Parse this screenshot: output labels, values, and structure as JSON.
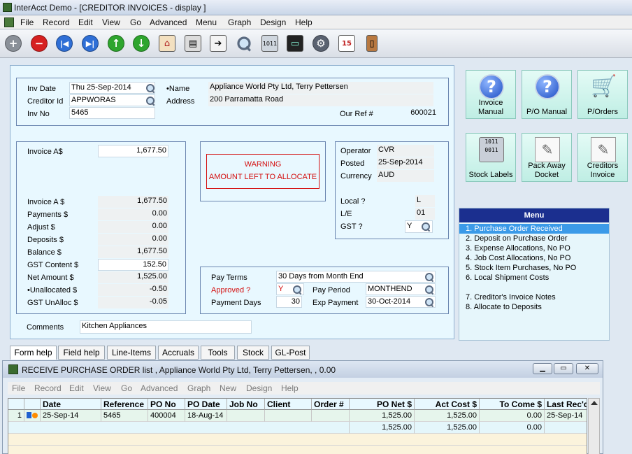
{
  "window": {
    "title": "InterAcct Demo - [CREDITOR INVOICES - display ]"
  },
  "menubar": [
    "File",
    "Record",
    "Edit",
    "View",
    "Go",
    "Advanced",
    "Menu",
    "Graph",
    "Design",
    "Help"
  ],
  "header": {
    "inv_date_label": "Inv Date",
    "inv_date": "Thu 25-Sep-2014",
    "creditor_id_label": "Creditor Id",
    "creditor_id": "APPWORAS",
    "inv_no_label": "Inv No",
    "inv_no": "5465",
    "name_label": "•Name",
    "name": "Appliance World Pty Ltd, Terry Pettersen",
    "address_label": "Address",
    "address": "200 Parramatta Road",
    "our_ref_label": "Our Ref #",
    "our_ref": "600021"
  },
  "amounts": {
    "invoice_top_label": "Invoice   A$",
    "invoice_top": "1,677.50",
    "invoice_label": "Invoice   A $",
    "invoice": "1,677.50",
    "payments_label": "Payments  $",
    "payments": "0.00",
    "adjust_label": "Adjust $",
    "adjust": "0.00",
    "deposits_label": "Deposits $",
    "deposits": "0.00",
    "balance_label": "Balance    $",
    "balance": "1,677.50",
    "gst_content_label": "GST Content  $",
    "gst_content": "152.50",
    "net_amount_label": "Net Amount  $",
    "net_amount": "1,525.00",
    "unallocated_label": "•Unallocated $",
    "unallocated": "-0.50",
    "gst_unalloc_label": "GST UnAlloc  $",
    "gst_unalloc": "-0.05"
  },
  "warning": {
    "line1": "WARNING",
    "line2": "AMOUNT LEFT TO ALLOCATE"
  },
  "operator_info": {
    "operator_label": "Operator",
    "operator": "CVR",
    "posted_label": "Posted",
    "posted": "25-Sep-2014",
    "currency_label": "Currency",
    "currency": "AUD",
    "local_label": "Local ?",
    "local": "L",
    "le_label": "L/E",
    "le": "01",
    "gst_label": "GST ?",
    "gst": "Y"
  },
  "payment": {
    "pay_terms_label": "Pay Terms",
    "pay_terms": "30 Days from Month End",
    "approved_label": "Approved ?",
    "approved": "Y",
    "pay_period_label": "Pay Period",
    "pay_period": "MONTHEND",
    "payment_days_label": "Payment Days",
    "payment_days": "30",
    "exp_payment_label": "Exp Payment",
    "exp_payment": "30-Oct-2014"
  },
  "comments": {
    "label": "Comments",
    "value": "Kitchen Appliances"
  },
  "side_buttons": [
    {
      "l1": "Invoice",
      "l2": "Manual"
    },
    {
      "l1": "P/O Manual",
      "l2": ""
    },
    {
      "l1": "P/Orders",
      "l2": ""
    },
    {
      "l1": "Stock Labels",
      "l2": ""
    },
    {
      "l1": "Pack Away",
      "l2": "Docket"
    },
    {
      "l1": "Creditors",
      "l2": "Invoice"
    }
  ],
  "menu_panel": {
    "title": "Menu",
    "items": [
      "1. Purchase Order Received",
      "2. Deposit on Purchase Order",
      "3. Expense Allocations,  No PO",
      "4. Job Cost Allocations, No PO",
      "5. Stock Item Purchases, No PO",
      "6. Local Shipment Costs",
      "7. Creditor's Invoice Notes",
      "8. Allocate to Deposits"
    ]
  },
  "tabs": [
    "Form help",
    "Field help",
    "Line-Items",
    "Accruals",
    "Tools",
    "Stock",
    "GL-Post"
  ],
  "subwindow": {
    "title": "RECEIVE PURCHASE ORDER list , Appliance World Pty Ltd, Terry Pettersen, , 0.00",
    "menu": [
      "File",
      "Record",
      "Edit",
      "View",
      "Go",
      "Advanced",
      "Graph",
      "New",
      "Design",
      "Help"
    ],
    "columns": [
      "Date",
      "Reference",
      "PO No",
      "PO Date",
      "Job No",
      "Client",
      "Order #",
      "PO Net $",
      "Act Cost $",
      "To Come $",
      "Last Rec'd"
    ],
    "row1": {
      "num": "1",
      "date": "25-Sep-14",
      "reference": "5465",
      "po_no": "400004",
      "po_date": "18-Aug-14",
      "job_no": "",
      "client": "",
      "order": "",
      "po_net": "1,525.00",
      "act_cost": "1,525.00",
      "to_come": "0.00",
      "last_recd": "25-Sep-14"
    },
    "totals": {
      "po_net": "1,525.00",
      "act_cost": "1,525.00",
      "to_come": "0.00"
    }
  },
  "icons": [
    "add-icon",
    "delete-icon",
    "first-record-icon",
    "last-record-icon",
    "previous-icon",
    "next-icon",
    "home-icon",
    "print-icon",
    "export-icon",
    "search-icon",
    "barcode-icon",
    "monitor-icon",
    "settings-icon",
    "calendar-icon",
    "exit-door-icon"
  ],
  "colors": {
    "form_bg": "#e8f8ff",
    "menu_header": "#1b2f8f",
    "menu_selected": "#3b9ae8",
    "warning": "#d41010",
    "button_bg": "#bfeee4"
  }
}
